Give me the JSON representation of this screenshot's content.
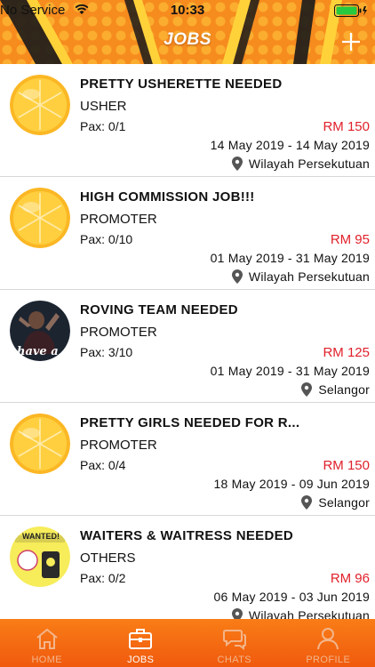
{
  "status_bar": {
    "carrier": "No Service",
    "time": "10:33"
  },
  "header": {
    "title": "JOBS",
    "add_icon": "plus-icon"
  },
  "colors": {
    "brand_orange": "#f68b1e",
    "pay_red": "#e0202a",
    "tab_inactive": "#f3b58a"
  },
  "jobs": [
    {
      "title": "PRETTY USHERETTE NEEDED",
      "category": "USHER",
      "pax": "Pax: 0/1",
      "pay": "RM 150",
      "dates": "14 May 2019 - 14 May 2019",
      "location": "Wilayah Persekutuan",
      "avatar": "orange-slice"
    },
    {
      "title": "HIGH COMMISSION JOB!!!",
      "category": "PROMOTER",
      "pax": "Pax: 0/10",
      "pay": "RM 95",
      "dates": "01 May 2019 - 31 May 2019",
      "location": "Wilayah Persekutuan",
      "avatar": "orange-slice"
    },
    {
      "title": "ROVING TEAM NEEDED",
      "category": "PROMOTER",
      "pax": "Pax: 3/10",
      "pay": "RM 125",
      "dates": "01 May 2019 - 31 May 2019",
      "location": "Selangor",
      "avatar": "team-photo",
      "avatar_text": "have a"
    },
    {
      "title": "PRETTY GIRLS NEEDED FOR R...",
      "category": "PROMOTER",
      "pax": "Pax: 0/4",
      "pay": "RM 150",
      "dates": "18 May 2019 - 09 Jun 2019",
      "location": "Selangor",
      "avatar": "orange-slice"
    },
    {
      "title": "WAITERS & WAITRESS NEEDED",
      "category": "OTHERS",
      "pax": "Pax: 0/2",
      "pay": "RM 96",
      "dates": "06 May 2019 - 03 Jun 2019",
      "location": "Wilayah Persekutuan",
      "avatar": "cafe-poster",
      "avatar_text": "WANTED!"
    }
  ],
  "tabs": [
    {
      "label": "HOME",
      "icon": "home-icon",
      "active": false
    },
    {
      "label": "JOBS",
      "icon": "briefcase-icon",
      "active": true
    },
    {
      "label": "CHATS",
      "icon": "chat-icon",
      "active": false
    },
    {
      "label": "PROFILE",
      "icon": "profile-icon",
      "active": false
    }
  ]
}
